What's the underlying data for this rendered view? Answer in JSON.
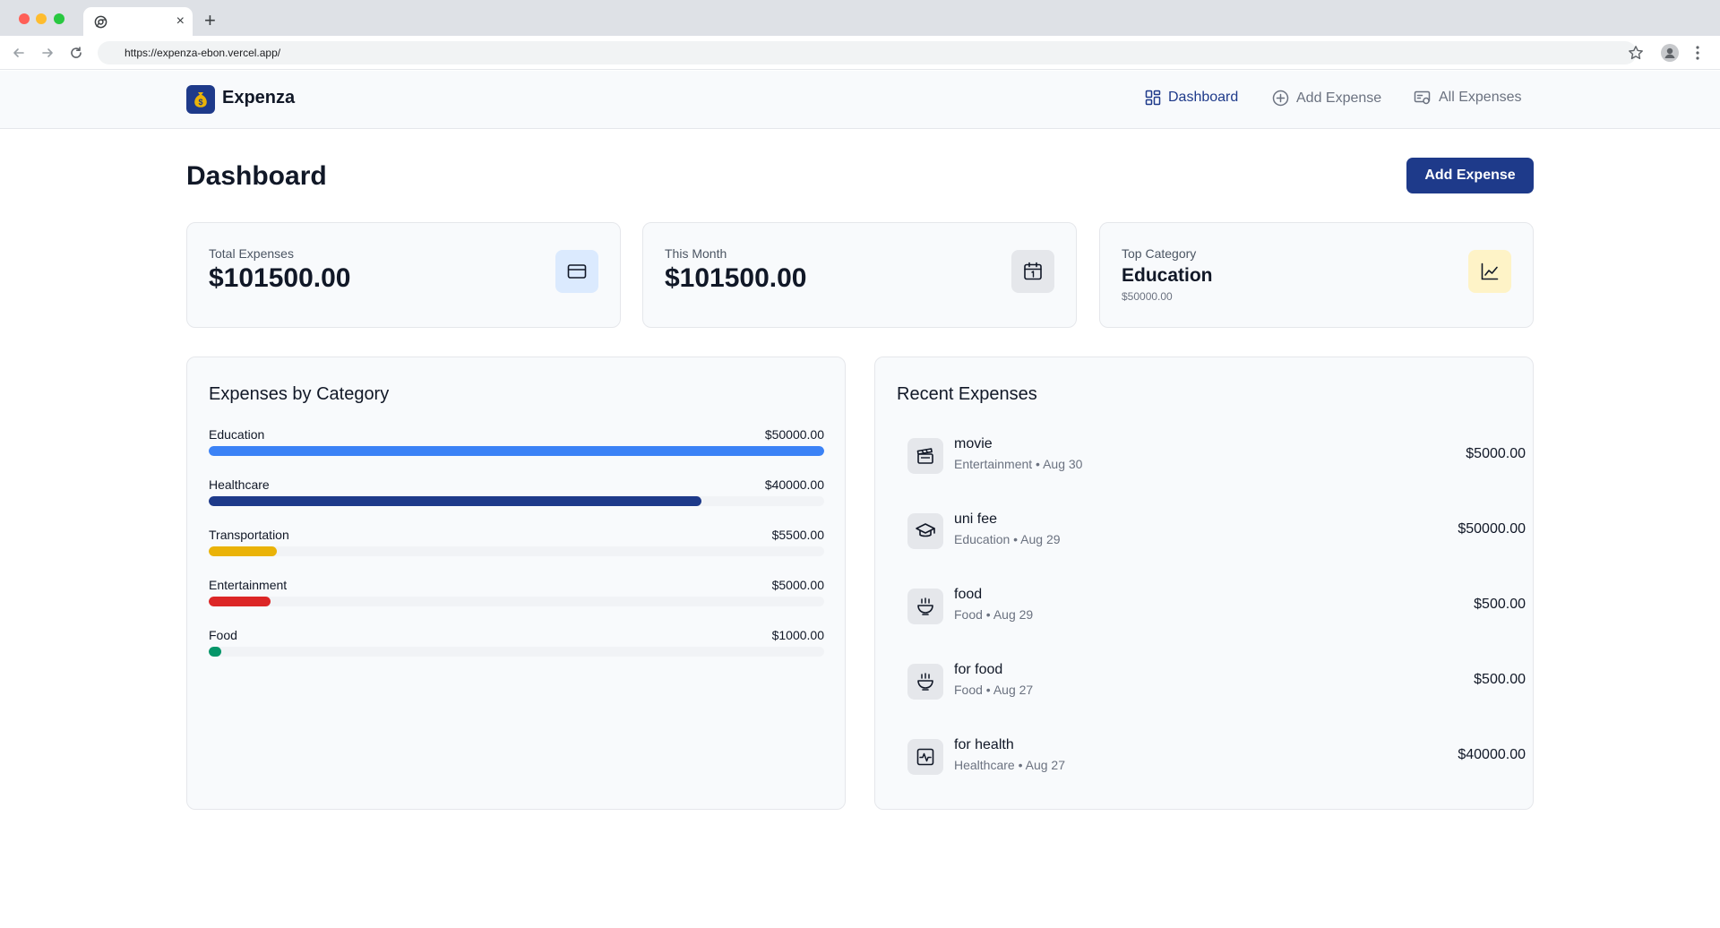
{
  "browser": {
    "url": "https://expenza-ebon.vercel.app/",
    "tab_close": "×",
    "new_tab": "+"
  },
  "header": {
    "brand": "Expenza",
    "logo_icon": "money-bag-icon",
    "nav": [
      {
        "label": "Dashboard",
        "icon": "grid-icon",
        "active": true
      },
      {
        "label": "Add Expense",
        "icon": "plus-circle-icon",
        "active": false
      },
      {
        "label": "All Expenses",
        "icon": "receipt-icon",
        "active": false
      }
    ]
  },
  "page": {
    "title": "Dashboard",
    "add_button": "Add Expense"
  },
  "stats": [
    {
      "label": "Total Expenses",
      "value": "$101500.00",
      "icon": "credit-card-icon"
    },
    {
      "label": "This Month",
      "value": "$101500.00",
      "icon": "calendar-icon"
    },
    {
      "label": "Top Category",
      "value": "Education",
      "sub": "$50000.00",
      "icon": "chart-line-icon"
    }
  ],
  "by_category": {
    "title": "Expenses by Category",
    "items": [
      {
        "name": "Education",
        "amount": "$50000.00",
        "value": 50000,
        "color": "#3b82f6"
      },
      {
        "name": "Healthcare",
        "amount": "$40000.00",
        "value": 40000,
        "color": "#1e3a8a"
      },
      {
        "name": "Transportation",
        "amount": "$5500.00",
        "value": 5500,
        "color": "#eab308"
      },
      {
        "name": "Entertainment",
        "amount": "$5000.00",
        "value": 5000,
        "color": "#dc2626"
      },
      {
        "name": "Food",
        "amount": "$1000.00",
        "value": 1000,
        "color": "#059669"
      }
    ]
  },
  "recent": {
    "title": "Recent Expenses",
    "items": [
      {
        "title": "movie",
        "meta": "Entertainment • Aug 30",
        "amount": "$5000.00",
        "icon": "clapperboard-icon"
      },
      {
        "title": "uni fee",
        "meta": "Education • Aug 29",
        "amount": "$50000.00",
        "icon": "graduation-cap-icon"
      },
      {
        "title": "food",
        "meta": "Food • Aug 29",
        "amount": "$500.00",
        "icon": "bowl-icon"
      },
      {
        "title": "for food",
        "meta": "Food • Aug 27",
        "amount": "$500.00",
        "icon": "bowl-icon"
      },
      {
        "title": "for health",
        "meta": "Healthcare • Aug 27",
        "amount": "$40000.00",
        "icon": "health-pulse-icon"
      }
    ]
  }
}
